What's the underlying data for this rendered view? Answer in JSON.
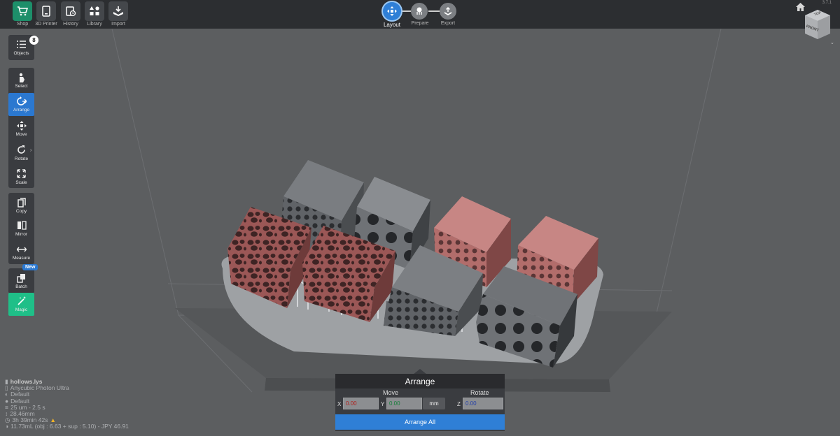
{
  "topbar": {
    "version": "3.7.1",
    "tools": [
      {
        "label": "Shop",
        "icon": "cart-icon"
      },
      {
        "label": "3D Printer",
        "icon": "printer-icon"
      },
      {
        "label": "History",
        "icon": "history-icon"
      },
      {
        "label": "Library",
        "icon": "library-icon"
      },
      {
        "label": "Import",
        "icon": "import-icon"
      }
    ],
    "steps": [
      {
        "label": "Layout",
        "active": true
      },
      {
        "label": "Prepare",
        "active": false
      },
      {
        "label": "Export",
        "active": false
      }
    ],
    "view_cube": {
      "top": "TOP",
      "front": "FRONT"
    }
  },
  "sidebar": {
    "objects_label": "Objects",
    "objects_count": "8",
    "tools": [
      {
        "label": "Select",
        "icon": "select-icon"
      },
      {
        "label": "Arrange",
        "icon": "arrange-icon",
        "active": true
      },
      {
        "label": "Move",
        "icon": "move-icon"
      },
      {
        "label": "Rotate",
        "icon": "rotate-icon"
      },
      {
        "label": "Scale",
        "icon": "scale-icon"
      },
      {
        "label": "Copy",
        "icon": "copy-icon"
      },
      {
        "label": "Mirror",
        "icon": "mirror-icon"
      },
      {
        "label": "Measure",
        "icon": "measure-icon"
      },
      {
        "label": "Batch",
        "icon": "batch-icon"
      },
      {
        "label": "Magic",
        "icon": "magic-icon"
      }
    ],
    "new_badge": "New"
  },
  "info": {
    "file": "hollows.lys",
    "printer": "Anycubic Photon Ultra",
    "profile1": "Default",
    "profile2": "Default",
    "layer": "25 um - 2.5 s",
    "height": "28.46mm",
    "time": "3h 39min 42s",
    "volume": "11.73mL (obj : 6.63 + sup : 5.10) - JPY 46.91"
  },
  "arrange_panel": {
    "title": "Arrange",
    "move_label": "Move",
    "rotate_label": "Rotate",
    "x_label": "X",
    "y_label": "Y",
    "z_label": "Z",
    "x_value": "0.00",
    "y_value": "0.00",
    "z_value": "0.00",
    "unit": "mm",
    "arrange_all": "Arrange All"
  },
  "colors": {
    "accent": "#2f7fd6",
    "shop": "#1d8f6a",
    "magic": "#1fbf88",
    "object_red": "#8a4a4a",
    "object_grey": "#55585c"
  }
}
